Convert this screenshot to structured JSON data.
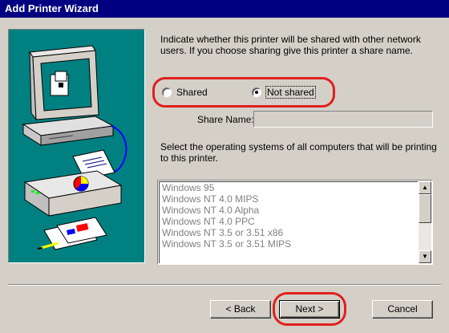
{
  "window": {
    "title": "Add Printer Wizard"
  },
  "intro_text": "Indicate whether this printer will be shared with other network users.  If you choose sharing give this printer a share name.",
  "sharing": {
    "shared_label": "Shared",
    "not_shared_label": "Not shared",
    "selected": "Not shared",
    "share_name_label": "Share Name:",
    "share_name_value": ""
  },
  "os_label": "Select the operating systems of all computers that will be printing to this printer.",
  "os_list": {
    "items": [
      "Windows 95",
      "Windows NT 4.0 MIPS",
      "Windows NT 4.0 Alpha",
      "Windows NT 4.0 PPC",
      "Windows NT 3.5 or 3.51 x86",
      "Windows NT 3.5 or 3.51 MIPS"
    ]
  },
  "buttons": {
    "back": "< Back",
    "next": "Next >",
    "cancel": "Cancel"
  },
  "colors": {
    "titlebar": "#000080",
    "dialog_bg": "#d4d0c8",
    "illustration_bg": "#008080",
    "highlight": "#e0201f"
  },
  "icons": [
    "computer-illustration",
    "printer-illustration",
    "documents-illustration",
    "scroll-up-icon",
    "scroll-down-icon"
  ]
}
